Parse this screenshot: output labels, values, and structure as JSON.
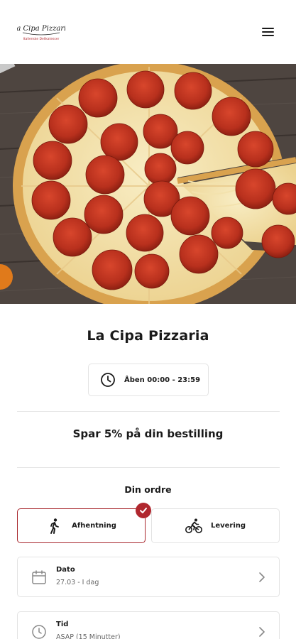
{
  "brand": {
    "name": "La Cipa Pizzaria",
    "tagline": "Italienske Delikatesser"
  },
  "restaurant": {
    "name": "La Cipa Pizzaria",
    "hours": "Åben 00:00 - 23:59"
  },
  "promo": "Spar 5% på din bestilling",
  "order": {
    "heading": "Din ordre",
    "options": [
      {
        "label": "Afhentning",
        "icon": "walking-person-icon",
        "selected": true
      },
      {
        "label": "Levering",
        "icon": "cyclist-icon",
        "selected": false
      }
    ],
    "date": {
      "label": "Dato",
      "value": "27.03 - I dag"
    },
    "time": {
      "label": "Tid",
      "value": "ASAP (15 Minutter)"
    }
  },
  "colors": {
    "accent": "#b0272e",
    "text": "#1a1a1a",
    "border": "#e3e3e3"
  }
}
